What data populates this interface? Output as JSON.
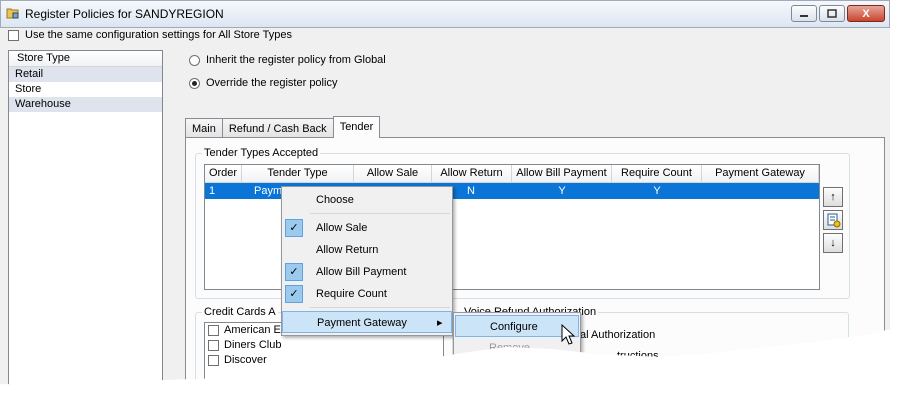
{
  "window": {
    "title": "Register Policies for SANDYREGION",
    "close_glyph": "X"
  },
  "same_config": {
    "label": "Use the same configuration settings for All Store Types",
    "checked": false
  },
  "store_types": {
    "header": "Store Type",
    "items": [
      "Retail",
      "Store",
      "Warehouse"
    ]
  },
  "policy": {
    "inherit_label": "Inherit the register policy from Global",
    "override_label": "Override the register policy",
    "selected": "override"
  },
  "tabs": [
    "Main",
    "Refund / Cash Back",
    "Tender"
  ],
  "active_tab": "Tender",
  "tender": {
    "group_title": "Tender Types Accepted",
    "columns": [
      "Order",
      "Tender Type",
      "Allow Sale",
      "Allow Return",
      "Allow Bill Payment",
      "Require Count",
      "Payment Gateway"
    ],
    "rows": [
      {
        "order": "1",
        "tender_type": "Paym",
        "allow_sale": "",
        "allow_return": "N",
        "allow_bill_payment": "Y",
        "require_count": "Y",
        "payment_gateway": ""
      }
    ],
    "up_glyph": "↑",
    "down_glyph": "↓"
  },
  "credit_cards": {
    "group_title": "Credit Cards A",
    "items": [
      "American Express",
      "Diners Club",
      "Discover"
    ]
  },
  "voice_refund": {
    "group_title": "Voice Refund Authorization",
    "label1": "al Authorization",
    "label2": "tructions"
  },
  "context_menu": {
    "items": [
      {
        "label": "Choose",
        "checked": false
      },
      {
        "label": "Allow Sale",
        "checked": true
      },
      {
        "label": "Allow Return",
        "checked": false
      },
      {
        "label": "Allow Bill Payment",
        "checked": true
      },
      {
        "label": "Require Count",
        "checked": true
      },
      {
        "label": "Payment Gateway",
        "checked": false,
        "submenu_arrow": "▸"
      }
    ],
    "check_glyph": "✓"
  },
  "submenu": {
    "items": [
      "Configure",
      "Remove"
    ]
  }
}
